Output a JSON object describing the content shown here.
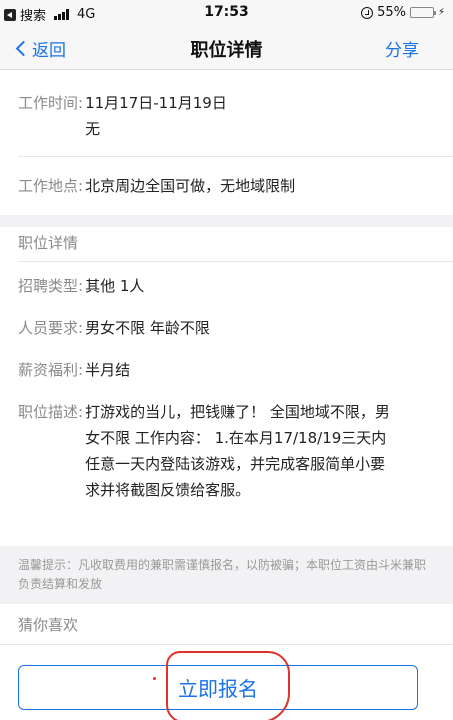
{
  "status_bar": {
    "back_app": "搜索",
    "network": "4G",
    "time": "17:53",
    "battery": "55%",
    "battery_level": 0.55
  },
  "nav": {
    "back_label": "返回",
    "title": "职位详情",
    "share_label": "分享"
  },
  "work_time": {
    "label": "工作时间:",
    "value_line1": "11月17日-11月19日",
    "value_line2": "无"
  },
  "work_place": {
    "label": "工作地点:",
    "value": "北京周边全国可做，无地域限制"
  },
  "detail_section": {
    "title": "职位详情",
    "recruit_type": {
      "label": "招聘类型:",
      "value": "其他 1人"
    },
    "requirement": {
      "label": "人员要求:",
      "value": "男女不限 年龄不限"
    },
    "salary": {
      "label": "薪资福利:",
      "value": "半月结"
    },
    "description": {
      "label": "职位描述:",
      "value": "打游戏的当儿，把钱赚了！ 全国地域不限，男女不限 工作内容： 1.在本月17/18/19三天内任意一天内登陆该游戏，并完成客服简单小要求并将截图反馈给客服。"
    }
  },
  "tip": "温馨提示：凡收取费用的兼职需谨慎报名，以防被骗；本职位工资由斗米兼职负责结算和发放",
  "guess_title": "猜你喜欢",
  "apply_button": "立即报名",
  "colors": {
    "accent": "#1a73e8",
    "annotation": "#e0322d",
    "band": "#f2f2f4"
  }
}
